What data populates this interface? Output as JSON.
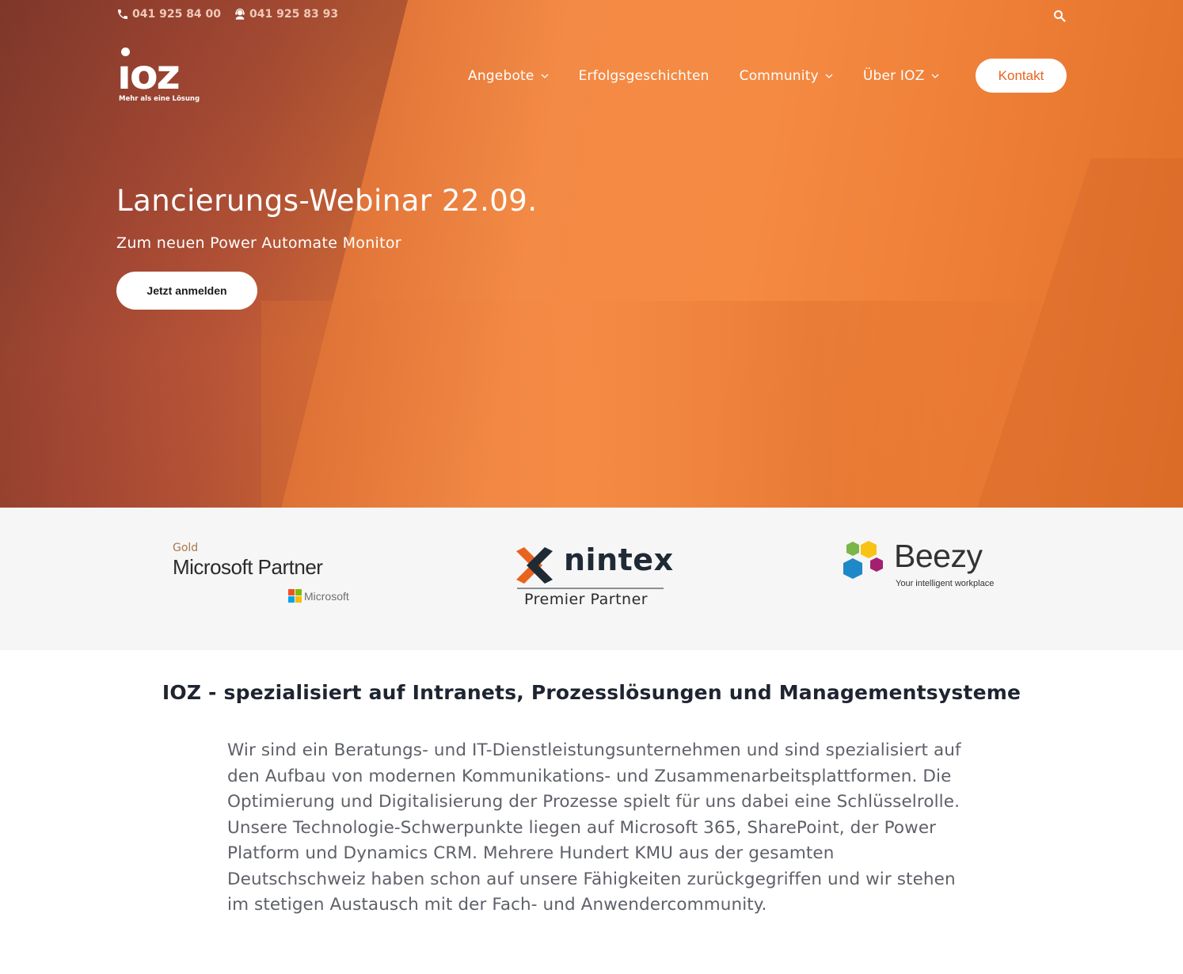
{
  "topbar": {
    "phone": {
      "icon": "phone-icon",
      "number": "041 925 84 00"
    },
    "support": {
      "icon": "headset-icon",
      "number": "041 925 83 93"
    },
    "search_icon": "search-icon"
  },
  "logo": {
    "mark": "ıoz",
    "tagline": "Mehr als eine Lösung"
  },
  "nav": {
    "items": [
      {
        "label": "Angebote",
        "has_dropdown": true
      },
      {
        "label": "Erfolgsgeschichten",
        "has_dropdown": false
      },
      {
        "label": "Community",
        "has_dropdown": true
      },
      {
        "label": "Über IOZ",
        "has_dropdown": true
      }
    ],
    "contact_label": "Kontakt"
  },
  "hero": {
    "title": "Lancierungs-Webinar 22.09.",
    "subtitle": "Zum neuen Power Automate Monitor",
    "cta_label": "Jetzt anmelden"
  },
  "partners": {
    "microsoft": {
      "level": "Gold",
      "title": "Microsoft Partner",
      "brand": "Microsoft"
    },
    "nintex": {
      "brand": "nintex",
      "level": "Premier Partner"
    },
    "beezy": {
      "brand": "Beezy",
      "tagline": "Your intelligent workplace"
    }
  },
  "main": {
    "heading": "IOZ - spezialisiert auf Intranets, Prozesslösungen und Managementsysteme",
    "intro": "Wir sind ein Beratungs- und IT-Dienstleistungsunternehmen und sind spezialisiert auf den Aufbau von modernen Kommunikations- und Zusammenarbeitsplattformen. Die Optimierung und Digitalisierung der Prozesse spielt für uns dabei eine Schlüsselrolle. Unsere Technologie-Schwerpunkte liegen auf Microsoft 365, SharePoint, der Power Platform und Dynamics CRM. Mehrere Hundert KMU aus der gesamten Deutschschweiz haben schon auf unsere Fähigkeiten zurückgegriffen und wir stehen im stetigen Austausch mit der Fach- und Anwendercommunity."
  },
  "colors": {
    "accent": "#e8641e",
    "hero_orange": "#f58a42",
    "heading": "#1e2430",
    "body_text": "#5e6168",
    "strip_bg": "#f6f6f6"
  }
}
